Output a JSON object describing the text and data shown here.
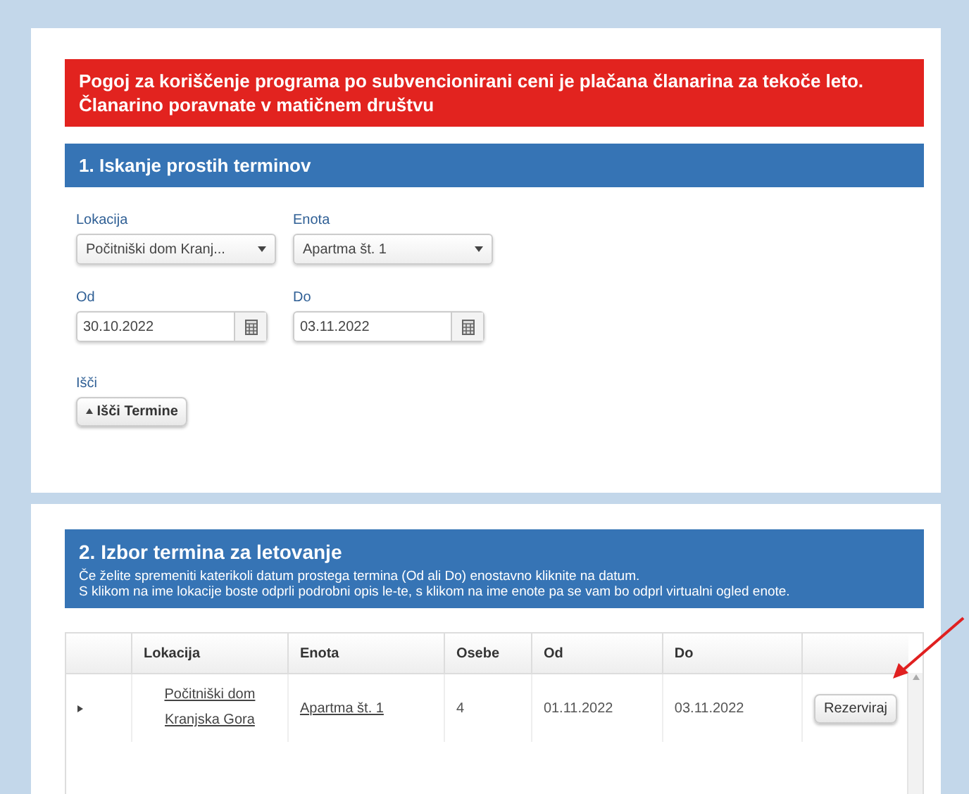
{
  "notice": "Pogoj za koriščenje programa po subvencionirani ceni je plačana članarina za tekoče leto. Članarino poravnate v matičnem društvu",
  "search_panel": {
    "title": "1. Iskanje prostih terminov",
    "fields": [
      {
        "label": "Lokacija",
        "kind": "select",
        "value": "Počitniški dom Kranj..."
      },
      {
        "label": "Enota",
        "kind": "select",
        "value": "Apartma št. 1"
      },
      {
        "label": "Od",
        "kind": "date",
        "value": "30.10.2022"
      },
      {
        "label": "Do",
        "kind": "date",
        "value": "03.11.2022"
      }
    ],
    "search_label": "Išči",
    "search_button": "Išči Termine"
  },
  "results_panel": {
    "title": "2. Izbor termina za letovanje",
    "help": [
      "Če želite spremeniti katerikoli datum prostega termina (Od ali Do) enostavno kliknite na datum.",
      "S klikom na ime lokacije boste odprli podrobni opis le-te, s klikom na ime enote pa se vam bo odprl virtualni ogled enote."
    ],
    "table": {
      "columns": [
        "Lokacija",
        "Enota",
        "Osebe",
        "Od",
        "Do"
      ],
      "rows": [
        {
          "lokacija": "Počitniški dom Kranjska Gora",
          "enota": "Apartma št. 1",
          "osebe": "4",
          "od": "01.11.2022",
          "do": "03.11.2022",
          "action": "Rezerviraj"
        }
      ]
    }
  },
  "annotation": {
    "kind": "arrow"
  }
}
